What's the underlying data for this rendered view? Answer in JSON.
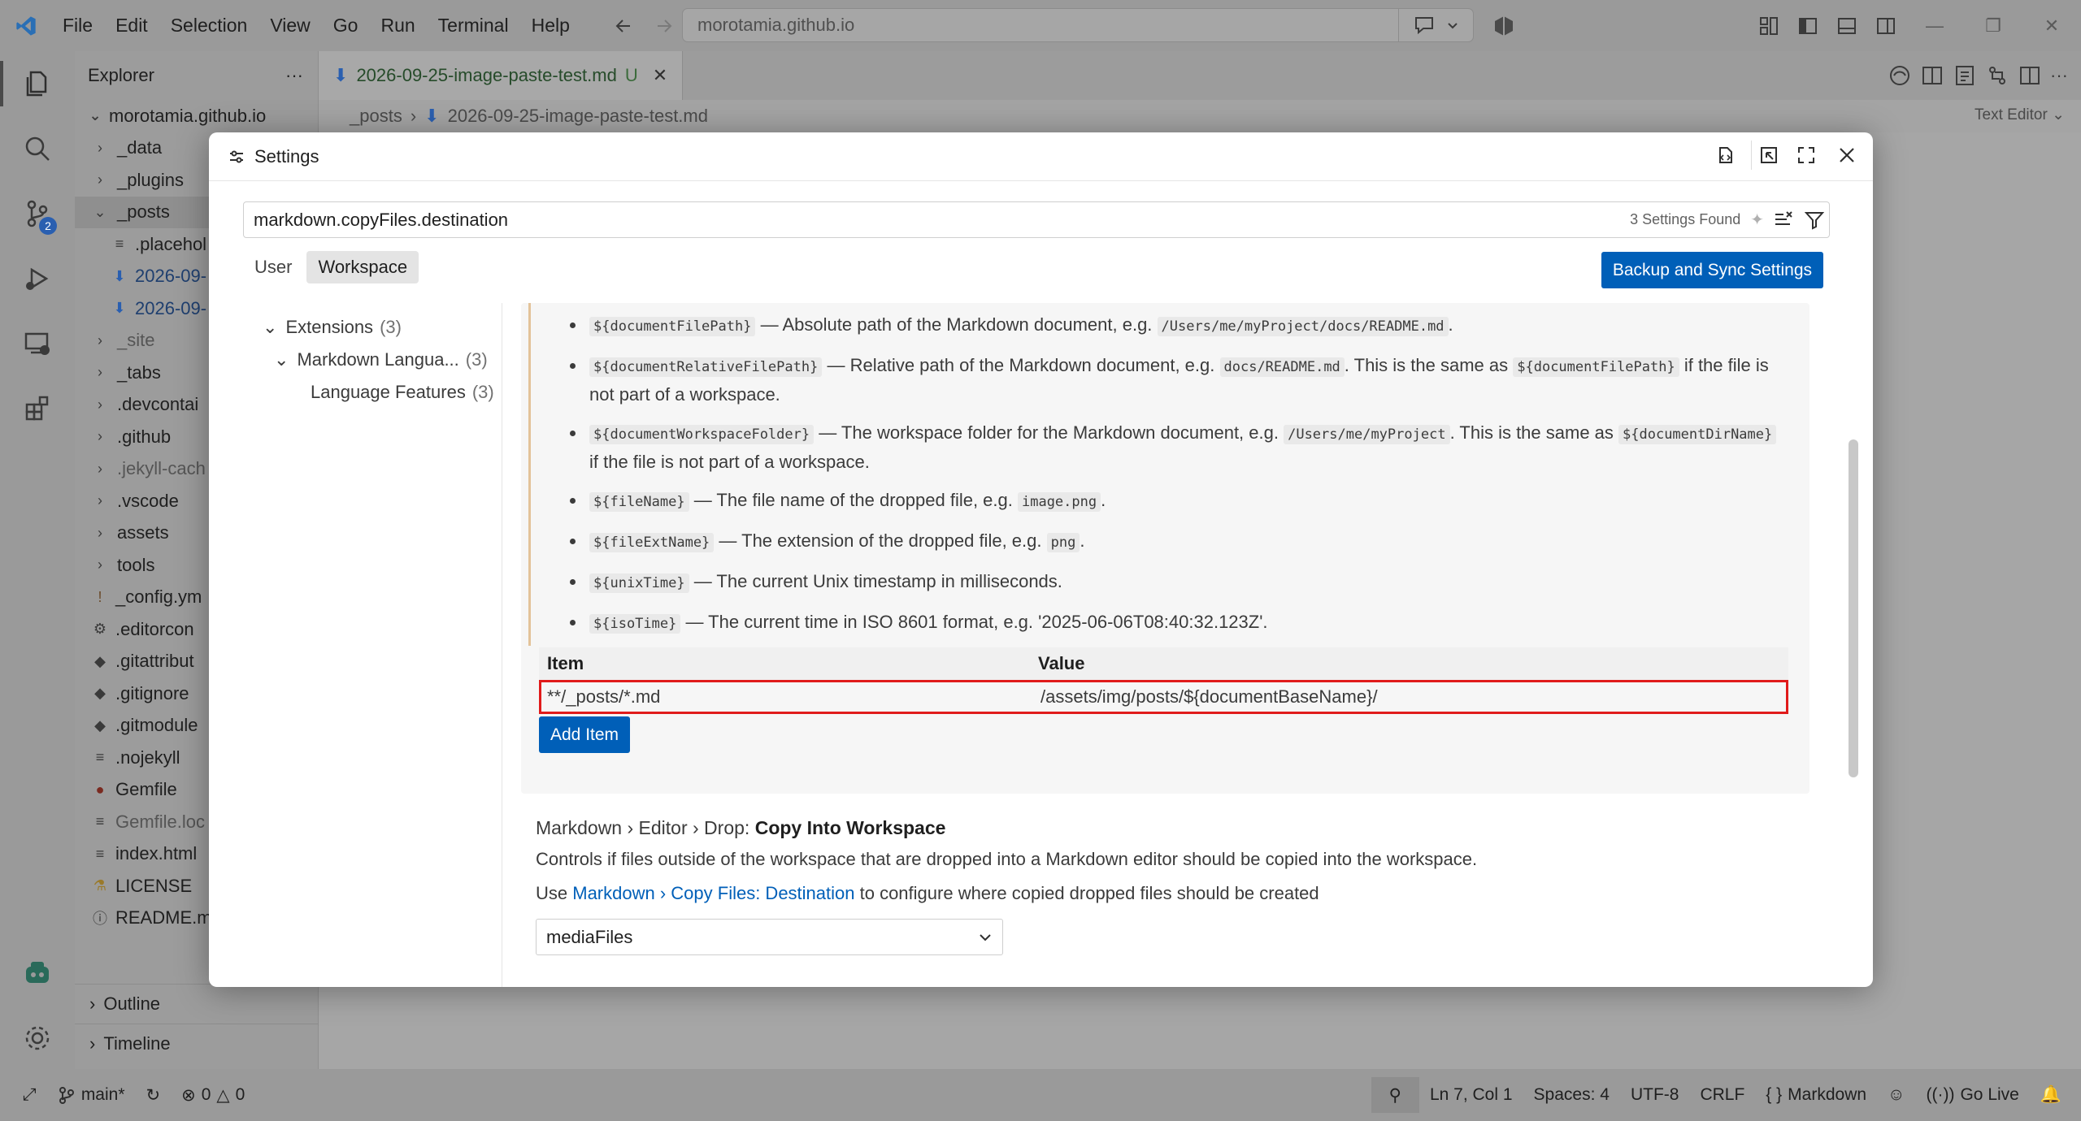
{
  "titlebar": {
    "menu": [
      "File",
      "Edit",
      "Selection",
      "View",
      "Go",
      "Run",
      "Terminal",
      "Help"
    ],
    "command_center": "morotamia.github.io"
  },
  "sidebar": {
    "title": "Explorer",
    "root": "morotamia.github.io",
    "items": [
      {
        "label": "_data",
        "type": "folder"
      },
      {
        "label": "_plugins",
        "type": "folder"
      },
      {
        "label": "_posts",
        "type": "folder-open"
      },
      {
        "label": ".placehol",
        "type": "file-child"
      },
      {
        "label": "2026-09-",
        "type": "md-child"
      },
      {
        "label": "2026-09-",
        "type": "md-child"
      },
      {
        "label": "_site",
        "type": "folder-dim"
      },
      {
        "label": "_tabs",
        "type": "folder"
      },
      {
        "label": ".devcontai",
        "type": "folder"
      },
      {
        "label": ".github",
        "type": "folder"
      },
      {
        "label": ".jekyll-cach",
        "type": "folder-dim"
      },
      {
        "label": ".vscode",
        "type": "folder"
      },
      {
        "label": "assets",
        "type": "folder"
      },
      {
        "label": "tools",
        "type": "folder"
      },
      {
        "label": "_config.ym",
        "type": "yml"
      },
      {
        "label": ".editorcon",
        "type": "gear"
      },
      {
        "label": ".gitattribut",
        "type": "git"
      },
      {
        "label": ".gitignore",
        "type": "git"
      },
      {
        "label": ".gitmodule",
        "type": "git"
      },
      {
        "label": ".nojekyll",
        "type": "lines"
      },
      {
        "label": "Gemfile",
        "type": "gem"
      },
      {
        "label": "Gemfile.loc",
        "type": "lines-dim"
      },
      {
        "label": "index.html",
        "type": "lines"
      },
      {
        "label": "LICENSE",
        "type": "license"
      },
      {
        "label": "README.m",
        "type": "info"
      }
    ],
    "outline": "Outline",
    "timeline": "Timeline",
    "scm_badge": "2"
  },
  "editor": {
    "tab_label": "2026-09-25-image-paste-test.md",
    "tab_status": "U",
    "breadcrumb_folder": "_posts",
    "breadcrumb_file": "2026-09-25-image-paste-test.md",
    "text_editor_label": "Text Editor"
  },
  "settings": {
    "title": "Settings",
    "search_value": "markdown.copyFiles.destination",
    "found": "3 Settings Found",
    "scopes": [
      "User",
      "Workspace"
    ],
    "backup_button": "Backup and Sync Settings",
    "toc": [
      {
        "label": "Extensions",
        "count": "(3)"
      },
      {
        "label": "Markdown Langua...",
        "count": "(3)"
      },
      {
        "label": "Language Features",
        "count": "(3)"
      }
    ],
    "vars": [
      {
        "code": "${documentFilePath}",
        "text": " — Absolute path of the Markdown document, e.g. ",
        "code2": "/Users/me/myProject/docs/README.md",
        "text2": "."
      },
      {
        "code": "${documentRelativeFilePath}",
        "text": " — Relative path of the Markdown document, e.g. ",
        "code2": "docs/README.md",
        "text2": ". This is the same as ",
        "code3": "${documentFilePath}",
        "text3": " if the file is not part of a workspace."
      },
      {
        "code": "${documentWorkspaceFolder}",
        "text": " — The workspace folder for the Markdown document, e.g. ",
        "code2": "/Users/me/myProject",
        "text2": ". This is the same as ",
        "code3": "${documentDirName}",
        "text3": " if the file is not part of a workspace."
      },
      {
        "code": "${fileName}",
        "text": " — The file name of the dropped file, e.g. ",
        "code2": "image.png",
        "text2": "."
      },
      {
        "code": "${fileExtName}",
        "text": " — The extension of the dropped file, e.g. ",
        "code2": "png",
        "text2": "."
      },
      {
        "code": "${unixTime}",
        "text": " — The current Unix timestamp in milliseconds."
      },
      {
        "code": "${isoTime}",
        "text": " — The current time in ISO 8601 format, e.g. '2025-06-06T08:40:32.123Z'."
      }
    ],
    "table": {
      "col_item": "Item",
      "col_value": "Value",
      "row_item": "**/_posts/*.md",
      "row_value": "/assets/img/posts/${documentBaseName}/"
    },
    "add_item": "Add Item",
    "setting2": {
      "breadcrumb": "Markdown › Editor › Drop: ",
      "name": "Copy Into Workspace",
      "description": "Controls if files outside of the workspace that are dropped into a Markdown editor should be copied into the workspace.",
      "use_prefix": "Use ",
      "link": "Markdown › Copy Files: Destination",
      "use_suffix": " to configure where copied dropped files should be created",
      "select_value": "mediaFiles"
    }
  },
  "statusbar": {
    "branch": "main*",
    "errors": "0",
    "warnings": "0",
    "position": "Ln 7, Col 1",
    "spaces": "Spaces: 4",
    "encoding": "UTF-8",
    "eol": "CRLF",
    "language": "Markdown",
    "golive": "Go Live"
  }
}
